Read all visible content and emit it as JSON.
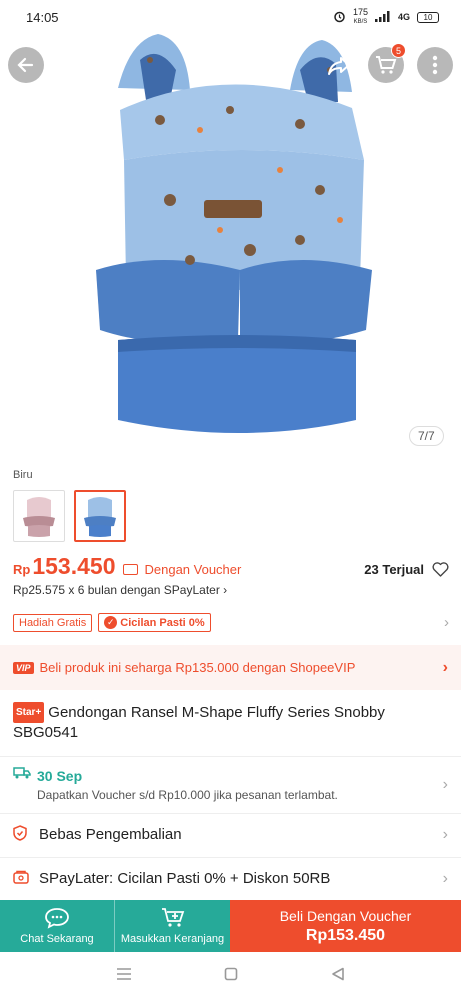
{
  "status_bar": {
    "time": "14:05",
    "net_speed": "175",
    "net_unit": "KB/S",
    "signal": "4G",
    "battery": "10"
  },
  "hero": {
    "image_counter": "7/7",
    "cart_badge": "5"
  },
  "variant": {
    "label": "Biru"
  },
  "price": {
    "currency": "Rp",
    "value": "153.450",
    "voucher_label": "Dengan Voucher",
    "sold": "23 Terjual",
    "installment": "Rp25.575 x 6 bulan dengan SPayLater"
  },
  "tags": {
    "hadiah": "Hadiah Gratis",
    "cicilan": "Cicilan Pasti 0%"
  },
  "vip": {
    "badge": "VIP",
    "text": "Beli produk ini seharga Rp135.000 dengan ShopeeVIP"
  },
  "product": {
    "badge": "Star+",
    "title": "Gendongan Ransel M-Shape Fluffy Series Snobby SBG0541"
  },
  "shipping": {
    "date": "30 Sep",
    "note": "Dapatkan Voucher s/d Rp10.000 jika pesanan terlambat."
  },
  "rows": {
    "return_policy": "Bebas Pengembalian",
    "spaylater": "SPayLater: Cicilan Pasti 0% + Diskon 50RB"
  },
  "bottom_bar": {
    "chat": "Chat Sekarang",
    "add_cart": "Masukkan Keranjang",
    "buy_label": "Beli Dengan Voucher",
    "buy_price": "Rp153.450"
  },
  "colors": {
    "accent": "#ee4d2d",
    "teal": "#26aa99",
    "carrier_blue": "#9fc3e6"
  }
}
